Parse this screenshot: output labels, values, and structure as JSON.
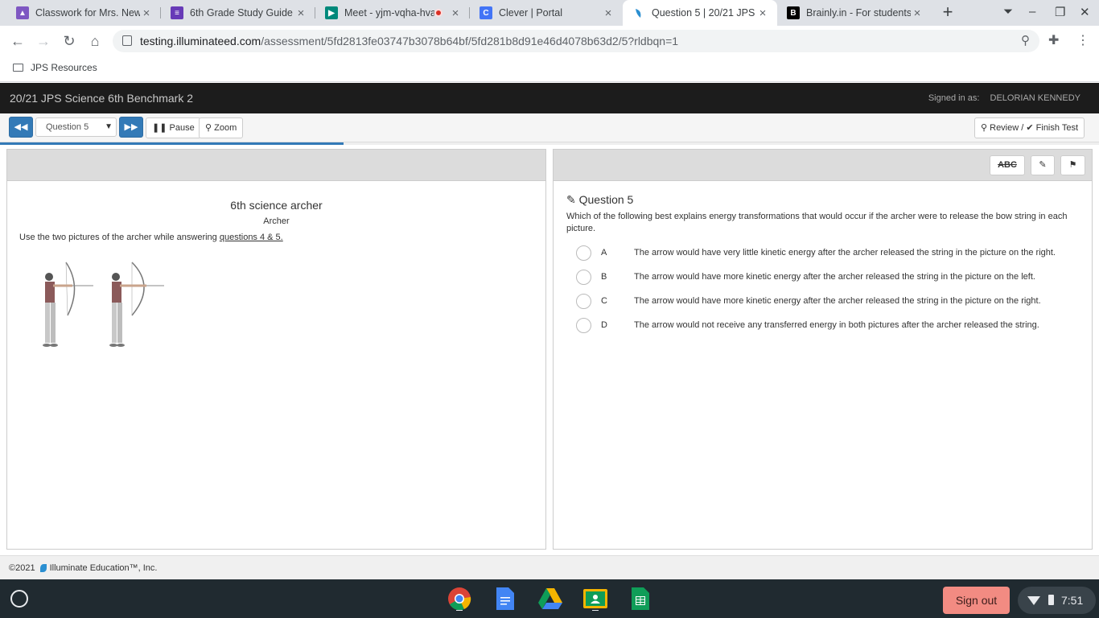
{
  "browser": {
    "tabs": [
      {
        "title": "Classwork for Mrs. New",
        "favicon_color": "#7e57c2",
        "active": false
      },
      {
        "title": "6th Grade Study Guide",
        "favicon_color": "#673ab7",
        "active": false
      },
      {
        "title": "Meet - yjm-vqha-hva",
        "favicon_color": "#00897b",
        "active": false,
        "recording": true
      },
      {
        "title": "Clever | Portal",
        "favicon_color": "#4274f6",
        "active": false
      },
      {
        "title": "Question 5 | 20/21 JPS",
        "favicon_color": "#2b8fd1",
        "active": true
      },
      {
        "title": "Brainly.in - For students",
        "favicon_color": "#000000",
        "active": false
      }
    ],
    "url_host": "testing.illuminateed.com",
    "url_path": "/assessment/5fd2813fe03747b3078b64bf/5fd281b8d91e46d4078b63d2/5?rldbqn=1",
    "bookmark": "JPS Resources"
  },
  "app": {
    "title": "20/21 JPS Science 6th Benchmark 2",
    "signed_in_label": "Signed in as:",
    "user_name": "DELORIAN KENNEDY",
    "question_select": "Question 5",
    "pause_label": "Pause",
    "zoom_label": "Zoom",
    "review_label": "Review /",
    "finish_label": "Finish Test",
    "progress": 0.3125,
    "accent_color": "#337ab7"
  },
  "passage": {
    "title": "6th science archer",
    "subtitle": "Archer",
    "instruction_prefix": "Use the two pictures of the archer while answering ",
    "instruction_link": "questions 4 & 5."
  },
  "question": {
    "tool_abc": "ABC",
    "label": "Question 5",
    "text": "Which of the following best explains energy transformations that would occur if the archer were to release the bow string in each picture.",
    "options": [
      {
        "letter": "A",
        "text": "The arrow would have very little kinetic energy after the archer released the string in the picture on the right."
      },
      {
        "letter": "B",
        "text": "The arrow would have more kinetic energy after the archer released the string in the picture on the left."
      },
      {
        "letter": "C",
        "text": "The arrow would have more kinetic energy after the archer released the string in the picture on the right."
      },
      {
        "letter": "D",
        "text": "The arrow would not receive any transferred energy in both pictures after the archer released the string."
      }
    ]
  },
  "footer": {
    "copyright": "©2021",
    "company": "Illuminate Education™, Inc."
  },
  "shelf": {
    "sign_out": "Sign out",
    "time": "7:51"
  }
}
